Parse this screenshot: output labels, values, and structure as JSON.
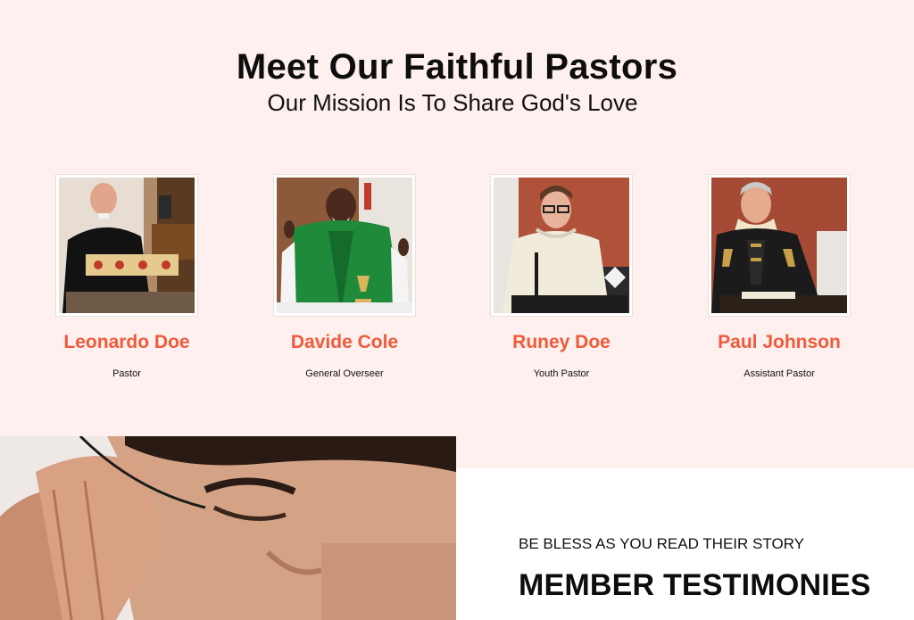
{
  "pastors_section": {
    "title": "Meet Our Faithful Pastors",
    "subtitle": "Our Mission Is To Share God's Love",
    "pastors": [
      {
        "name": "Leonardo Doe",
        "role": "Pastor"
      },
      {
        "name": "Davide Cole",
        "role": "General Overseer"
      },
      {
        "name": "Runey Doe",
        "role": "Youth Pastor"
      },
      {
        "name": "Paul Johnson",
        "role": "Assistant Pastor"
      }
    ]
  },
  "testimonies": {
    "kicker": "BE BLESS AS YOU READ THEIR STORY",
    "title": "MEMBER TESTIMONIES"
  },
  "colors": {
    "section_background": "#fdf0ee",
    "pastor_name_accent": "#f05a3a",
    "heading_text": "#0d0d0d"
  }
}
